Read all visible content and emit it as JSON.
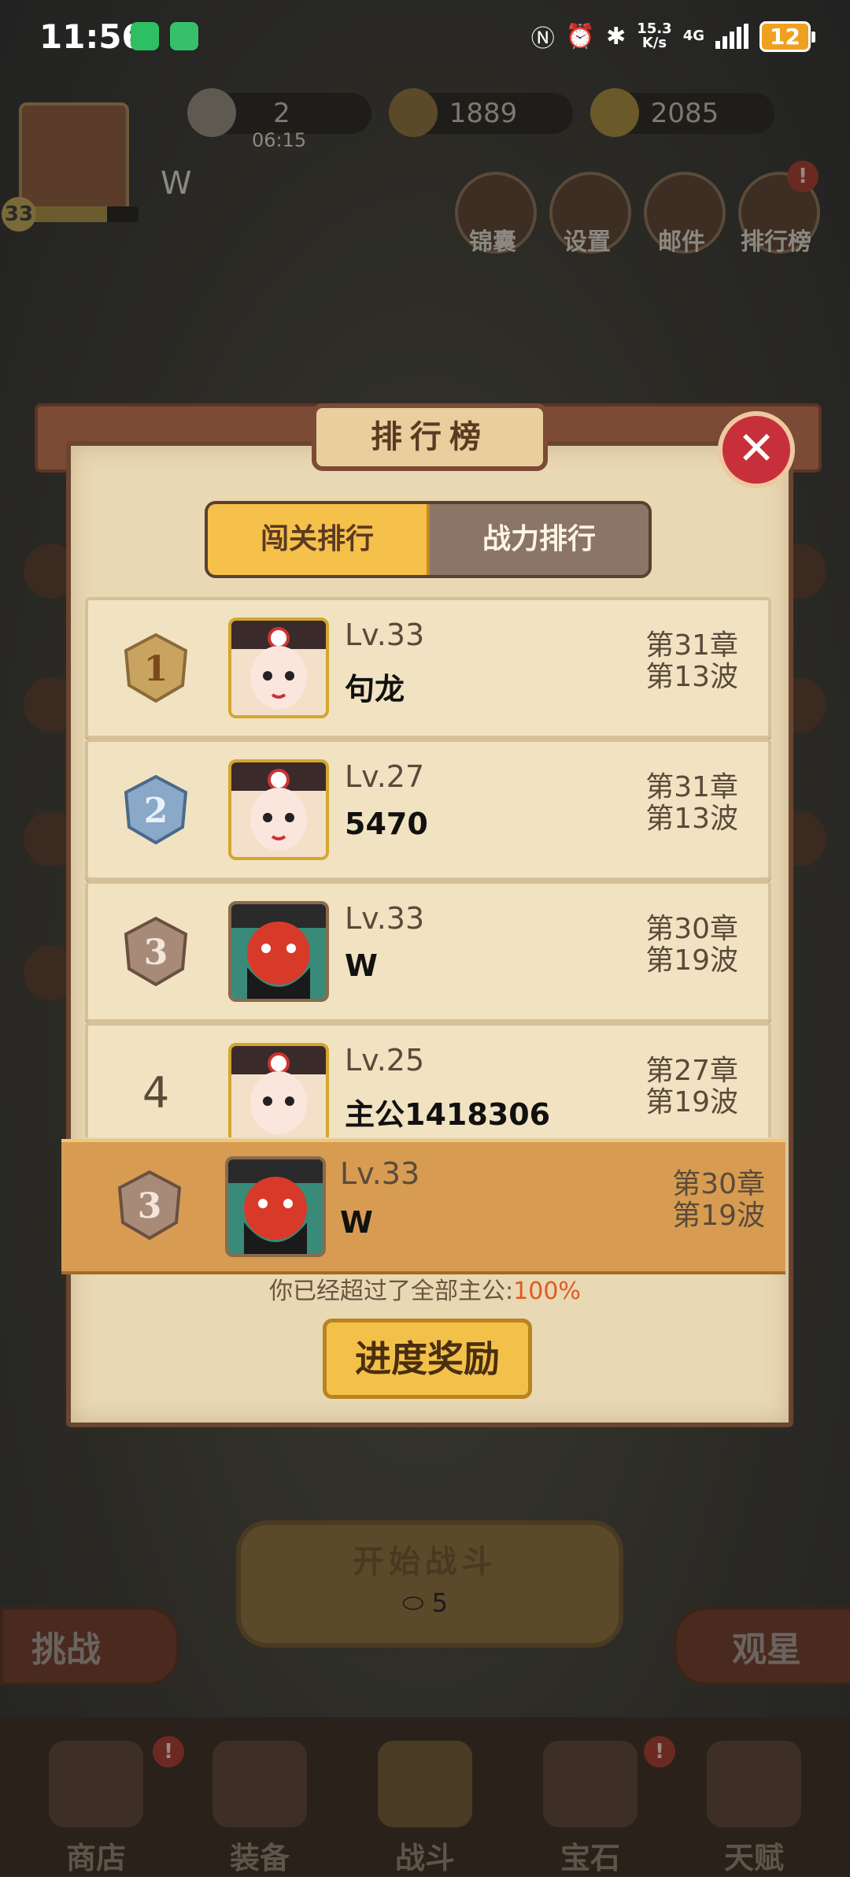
{
  "status_bar": {
    "time": "11:56",
    "net_speed": "15.3",
    "net_unit": "K/s",
    "network": "4G",
    "battery": "12"
  },
  "top": {
    "resource1": "2",
    "resource1_timer": "06:15",
    "coins": "1889",
    "gold": "2085",
    "player_level": "33",
    "player_name": "W",
    "buttons": [
      "锦囊",
      "设置",
      "邮件",
      "排行榜"
    ]
  },
  "modal": {
    "title": "排行榜",
    "tabs": [
      "闯关排行",
      "战力排行"
    ],
    "rows": [
      {
        "rank": "1",
        "level": "Lv.33",
        "name": "句龙",
        "chapter": "第31章",
        "wave": "第13波"
      },
      {
        "rank": "2",
        "level": "Lv.27",
        "name": "5470",
        "chapter": "第31章",
        "wave": "第13波"
      },
      {
        "rank": "3",
        "level": "Lv.33",
        "name": "W",
        "chapter": "第30章",
        "wave": "第19波"
      },
      {
        "rank": "4",
        "level": "Lv.25",
        "name": "主公1418306",
        "chapter": "第27章",
        "wave": "第19波"
      }
    ],
    "mine": {
      "rank": "3",
      "level": "Lv.33",
      "name": "W",
      "chapter": "第30章",
      "wave": "第19波"
    },
    "surpass_text": "你已经超过了全部主公:",
    "surpass_pct": "100%",
    "reward_button": "进度奖励"
  },
  "battle": {
    "start_label": "开始战斗",
    "cost": "5",
    "left_label": "挑战",
    "right_label": "观星"
  },
  "nav": [
    "商店",
    "装备",
    "战斗",
    "宝石",
    "天赋"
  ],
  "colors": {
    "accent": "#f5c14a",
    "paper": "#e9d8b4",
    "mine_row": "#d79c52",
    "close": "#c7303a"
  }
}
